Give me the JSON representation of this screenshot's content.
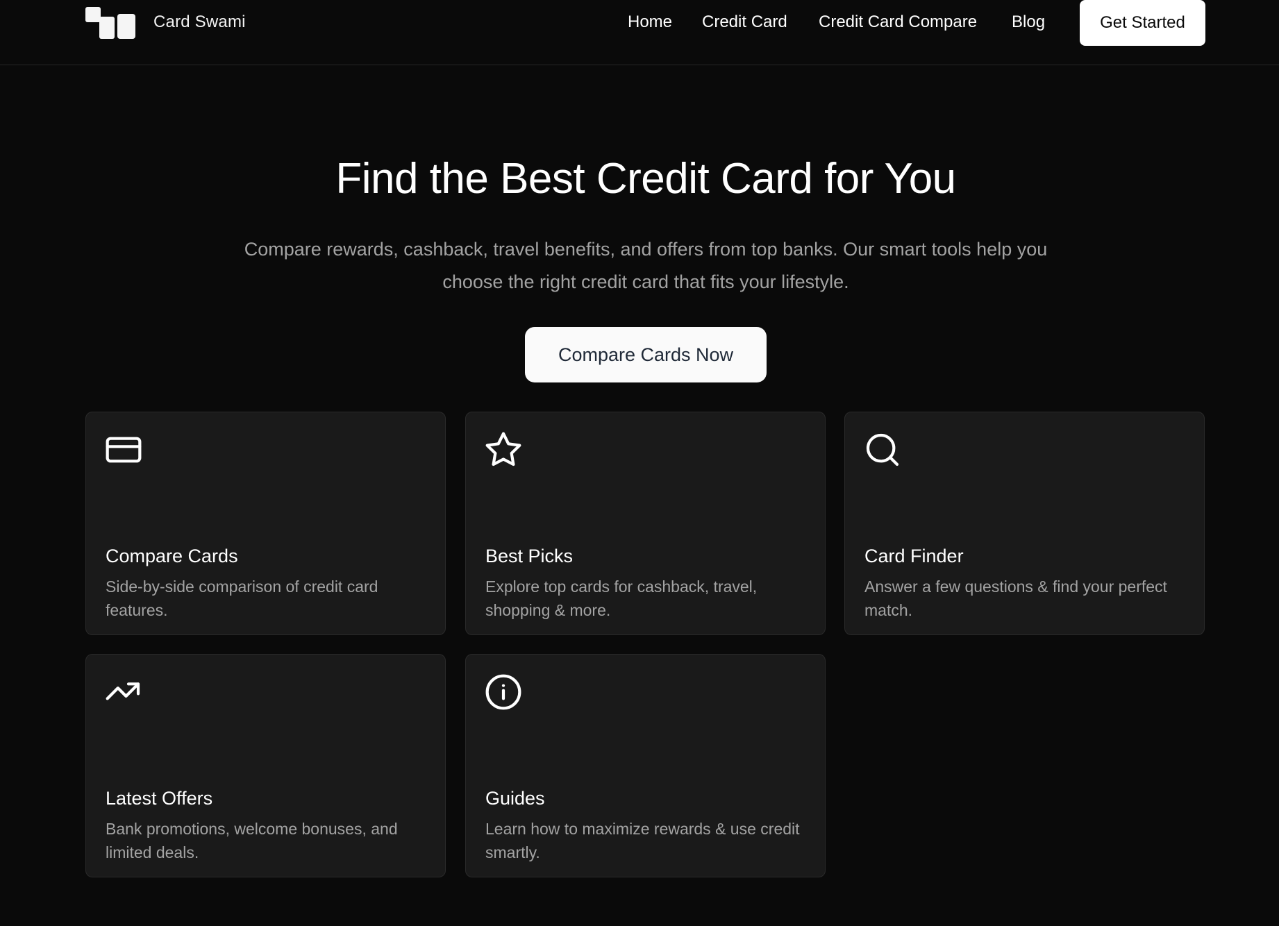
{
  "header": {
    "brand_name": "Card Swami",
    "logo_icon": "card-swami-logo-icon",
    "nav": [
      {
        "label": "Home"
      },
      {
        "label": "Credit Card"
      },
      {
        "label": "Credit Card Compare"
      },
      {
        "label": "Blog"
      }
    ],
    "cta_label": "Get Started"
  },
  "hero": {
    "title": "Find the Best Credit Card for You",
    "subtitle": "Compare rewards, cashback, travel benefits, and offers from top banks. Our smart tools help you choose the right credit card that fits your lifestyle.",
    "cta_label": "Compare Cards Now"
  },
  "features": [
    {
      "icon": "credit-card-icon",
      "title": "Compare Cards",
      "description": "Side-by-side comparison of credit card features."
    },
    {
      "icon": "star-icon",
      "title": "Best Picks",
      "description": "Explore top cards for cashback, travel, shopping & more."
    },
    {
      "icon": "search-icon",
      "title": "Card Finder",
      "description": "Answer a few questions & find your perfect match."
    },
    {
      "icon": "trending-up-icon",
      "title": "Latest Offers",
      "description": "Bank promotions, welcome bonuses, and limited deals."
    },
    {
      "icon": "info-icon",
      "title": "Guides",
      "description": "Learn how to maximize rewards & use credit smartly."
    }
  ],
  "colors": {
    "background": "#0a0a0a",
    "card_background": "#1a1a1a",
    "muted_text": "#a3a3a3",
    "button_background": "#ffffff"
  }
}
